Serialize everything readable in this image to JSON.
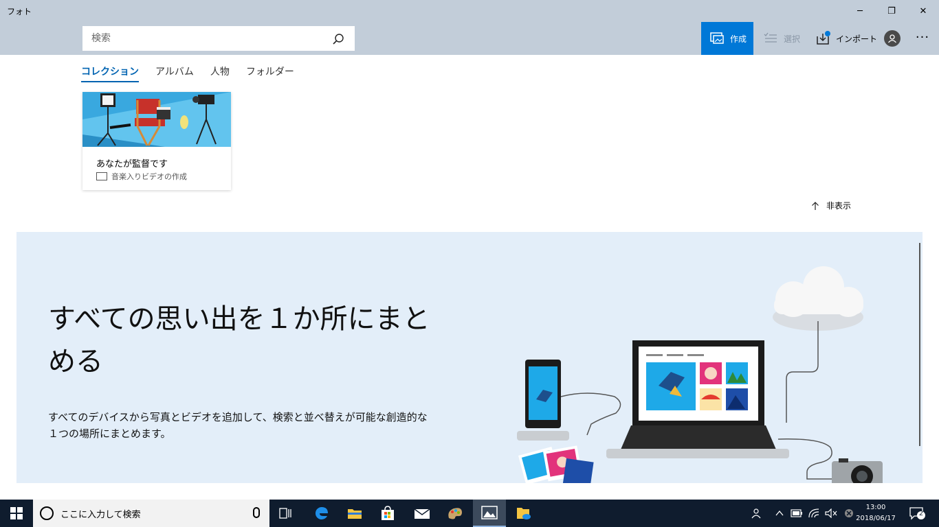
{
  "window": {
    "title": "フォト",
    "minimize": "─",
    "restore": "❐",
    "close": "✕"
  },
  "search": {
    "placeholder": "検索"
  },
  "commands": {
    "create": "作成",
    "select": "選択",
    "import": "インポート",
    "more": "···"
  },
  "tabs": [
    {
      "label": "コレクション",
      "active": true
    },
    {
      "label": "アルバム",
      "active": false
    },
    {
      "label": "人物",
      "active": false
    },
    {
      "label": "フォルダー",
      "active": false
    }
  ],
  "card": {
    "title": "あなたが監督です",
    "subtitle": "音楽入りビデオの作成"
  },
  "hide_link": "非表示",
  "banner": {
    "title": "すべての思い出を１か所にまとめる",
    "description": "すべてのデバイスから写真とビデオを追加して、検索と並べ替えが可能な創造的な１つの場所にまとめます。"
  },
  "taskbar": {
    "search_placeholder": "ここに入力して検索",
    "time": "13:00",
    "date": "2018/06/17",
    "notification_count": "2"
  },
  "colors": {
    "accent": "#0078d7",
    "header_bg": "#c2cdd9",
    "banner_bg": "#e3eef9",
    "taskbar": "#0f1c2e"
  }
}
